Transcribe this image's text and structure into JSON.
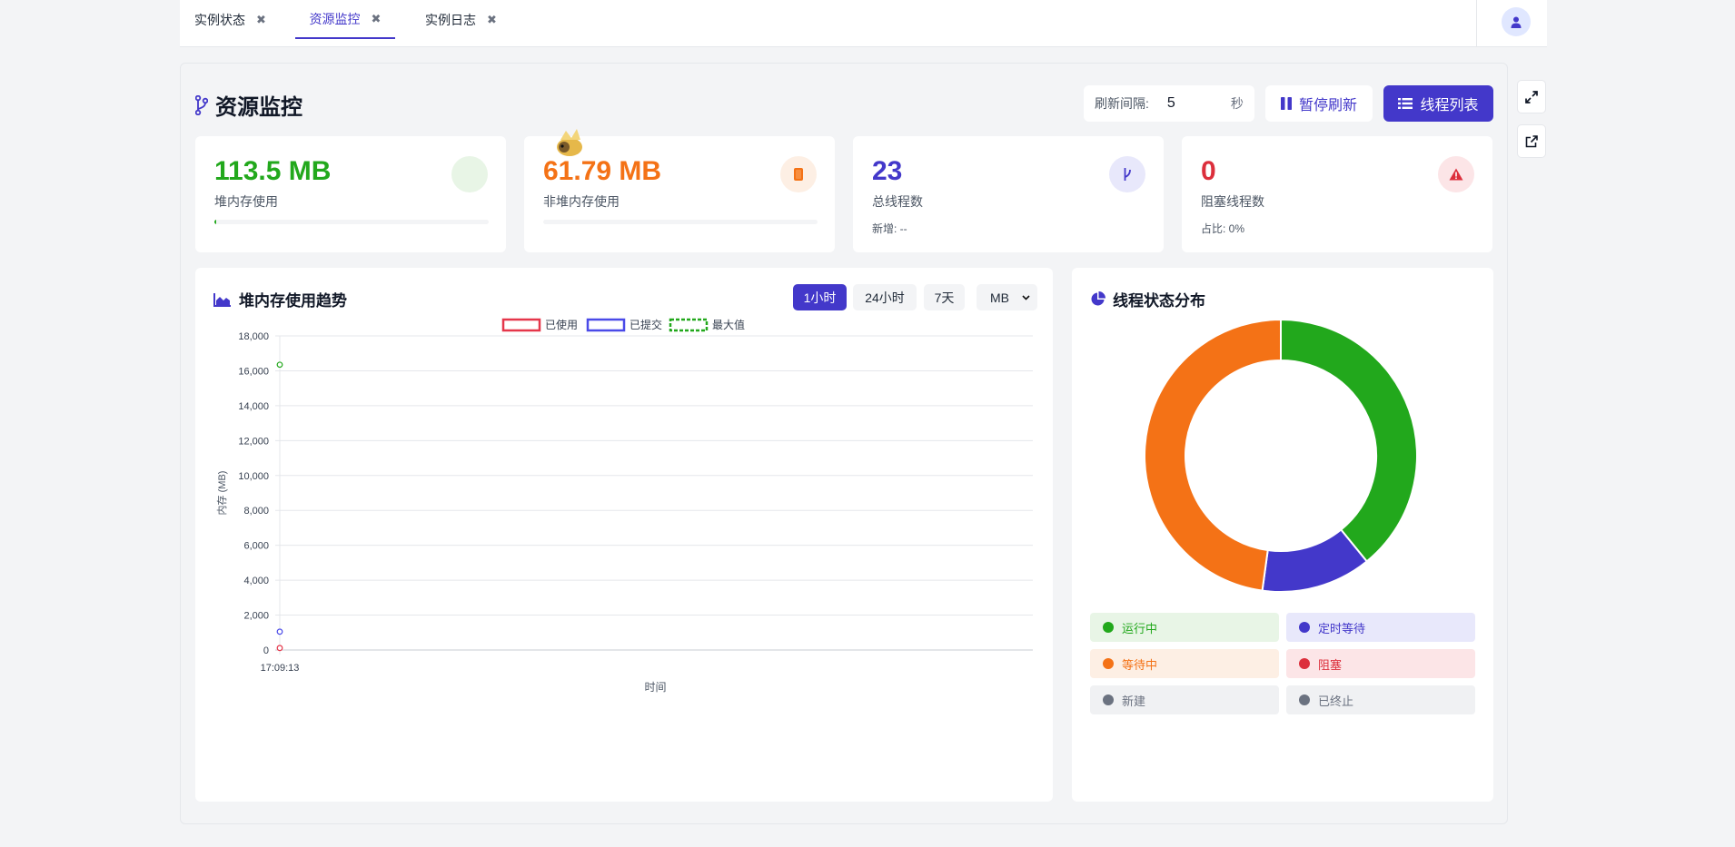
{
  "tabs": [
    {
      "label": "实例状态",
      "close": "✖"
    },
    {
      "label": "资源监控",
      "close": "✖"
    },
    {
      "label": "实例日志",
      "close": "✖"
    }
  ],
  "page": {
    "title": "资源监控",
    "refresh_label": "刷新间隔:",
    "refresh_value": "5",
    "refresh_unit": "秒",
    "pause_button": "暂停刷新",
    "threads_button": "线程列表"
  },
  "stats": {
    "heap": {
      "value": "113.5 MB",
      "label": "堆内存使用",
      "usage_fraction": 0.006,
      "color": "#22a81c"
    },
    "nonheap": {
      "value": "61.79 MB",
      "label": "非堆内存使用",
      "usage_fraction": 0.0,
      "color": "#f47216"
    },
    "threads": {
      "value": "23",
      "label": "总线程数",
      "sub": "新增: --",
      "color": "#4338ca"
    },
    "blocked": {
      "value": "0",
      "label": "阻塞线程数",
      "sub": "占比: 0%",
      "color": "#dc2f3c"
    }
  },
  "heap_chart": {
    "title": "堆内存使用趋势",
    "ranges": [
      "1小时",
      "24小时",
      "7天"
    ],
    "active_range": "1小时",
    "unit": "MB"
  },
  "thread_chart": {
    "title": "线程状态分布",
    "states": [
      {
        "label": "运行中",
        "color": "#22a81c",
        "bg": "#e8f5e6"
      },
      {
        "label": "定时等待",
        "color": "#4338ca",
        "bg": "#e8e8fb"
      },
      {
        "label": "等待中",
        "color": "#f47216",
        "bg": "#fdefe4"
      },
      {
        "label": "阻塞",
        "color": "#dc2f3c",
        "bg": "#fce5e7"
      },
      {
        "label": "新建",
        "color": "#6b7280",
        "bg": "#f0f1f3"
      },
      {
        "label": "已终止",
        "color": "#6b7280",
        "bg": "#f0f1f3"
      }
    ]
  },
  "chart_data": [
    {
      "type": "line",
      "title": "",
      "xlabel": "时间",
      "ylabel": "内存 (MB)",
      "ylim": [
        0,
        18000
      ],
      "yticks": [
        "0",
        "2,000",
        "4,000",
        "6,000",
        "8,000",
        "10,000",
        "12,000",
        "14,000",
        "16,000",
        "18,000"
      ],
      "x": [
        "17:09:13"
      ],
      "grid": true,
      "legend_position": "top",
      "series": [
        {
          "name": "已使用",
          "values": [
            113.5
          ],
          "color": "#e5364a",
          "style": "solid"
        },
        {
          "name": "已提交",
          "values": [
            1050
          ],
          "color": "#4a4ae8",
          "style": "solid"
        },
        {
          "name": "最大值",
          "values": [
            16350
          ],
          "color": "#22a81c",
          "style": "dashed"
        }
      ]
    },
    {
      "type": "pie",
      "title": "",
      "donut": true,
      "labels": [
        "运行中",
        "定时等待",
        "等待中",
        "阻塞",
        "新建",
        "已终止"
      ],
      "values": [
        9,
        3,
        11,
        0,
        0,
        0
      ],
      "colors": [
        "#22a81c",
        "#4338ca",
        "#f47216",
        "#dc2f3c",
        "#6b7280",
        "#6b7280"
      ]
    }
  ]
}
